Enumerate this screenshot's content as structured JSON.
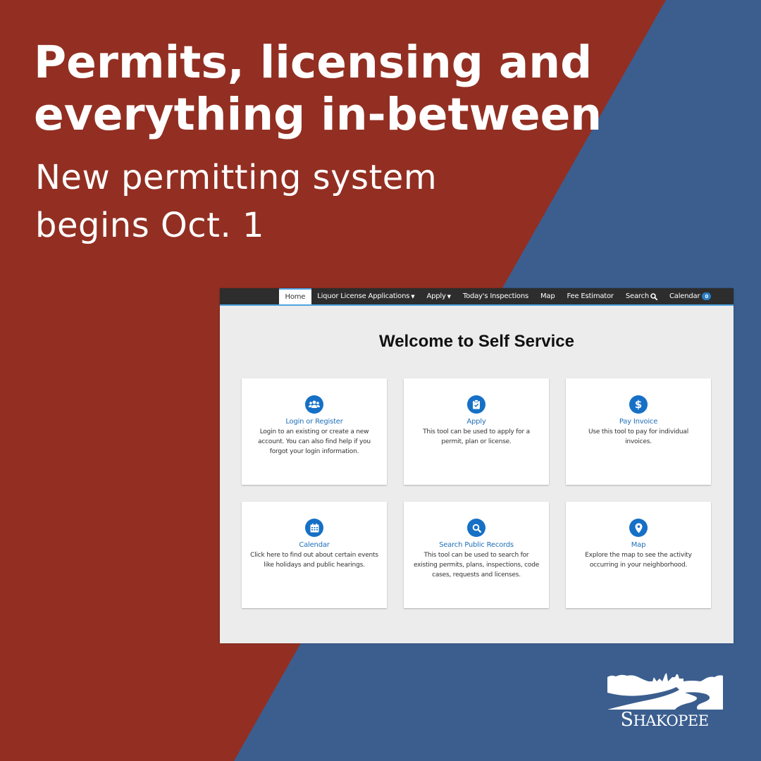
{
  "colors": {
    "red_panel": "#922F22",
    "blue_panel": "#3B5E8F",
    "nav_bg": "#2D2D2D",
    "nav_accent": "#4FA3E0",
    "tile_icon": "#1670C6",
    "tile_title": "#1F6FB8"
  },
  "headline": {
    "line1": "Permits, licensing and",
    "line2": "everything in-between"
  },
  "subhead": {
    "line1": "New permitting system",
    "line2": "begins Oct. 1"
  },
  "portal": {
    "nav": {
      "items": [
        {
          "label": "Home",
          "active": true
        },
        {
          "label": "Liquor License Applications",
          "dropdown": true
        },
        {
          "label": "Apply",
          "dropdown": true
        },
        {
          "label": "Today's Inspections"
        },
        {
          "label": "Map"
        },
        {
          "label": "Fee Estimator"
        },
        {
          "label": "Search",
          "icon": "search-icon"
        },
        {
          "label": "Calendar",
          "badge": "0"
        }
      ]
    },
    "welcome_title": "Welcome to Self Service",
    "tiles": [
      {
        "icon": "users-icon",
        "title": "Login or Register",
        "description": "Login to an existing or create a new account. You can also find help if you forgot your login information."
      },
      {
        "icon": "clipboard-check-icon",
        "title": "Apply",
        "description": "This tool can be used to apply for a permit, plan or license."
      },
      {
        "icon": "dollar-icon",
        "title": "Pay Invoice",
        "description": "Use this tool to pay for individual invoices."
      },
      {
        "icon": "calendar-icon",
        "title": "Calendar",
        "description": "Click here to find out about certain events like holidays and public hearings."
      },
      {
        "icon": "search-icon",
        "title": "Search Public Records",
        "description": "This tool can be used to search for existing permits, plans, inspections, code cases, requests and licenses."
      },
      {
        "icon": "map-pin-icon",
        "title": "Map",
        "description": "Explore the map to see the activity occurring in your neighborhood."
      }
    ]
  },
  "logo": {
    "name": "Shakopee",
    "wordmark_first": "S",
    "wordmark_rest": "HAKOPEE"
  }
}
